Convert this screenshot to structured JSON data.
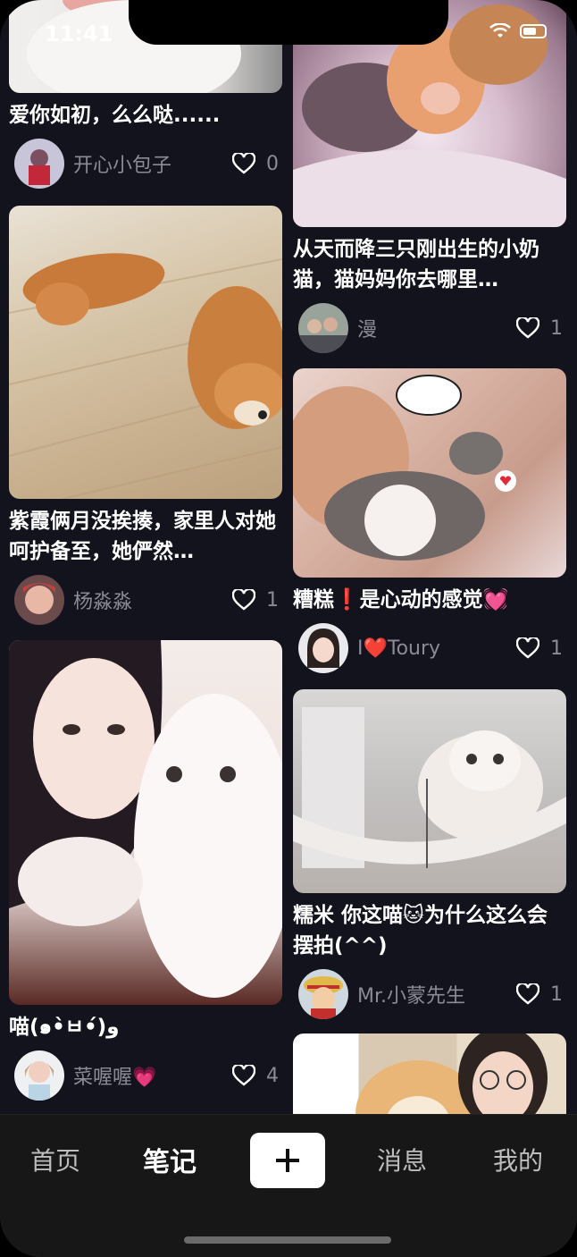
{
  "status_bar": {
    "time": "11:41"
  },
  "feed": {
    "left_column": [
      {
        "image": "white-dog-closeup-partial",
        "title": "爱你如初，么么哒......",
        "user": "开心小包子",
        "likes": "0",
        "avatar": "avatar-red-figure"
      },
      {
        "image": "two-shiba-dogs-on-floor",
        "title": "紫霞俩月没挨揍，家里人对她呵护备至，她俨然…",
        "user": "杨淼淼",
        "likes": "1",
        "avatar": "avatar-girl-red"
      },
      {
        "image": "girl-with-white-cats",
        "title": "喵(๑•̀ㅂ•́)و",
        "user": "菜喔喔💗",
        "likes": "4",
        "avatar": "avatar-girl-white"
      }
    ],
    "right_column": [
      {
        "image": "newborn-kittens-on-blanket",
        "title": "从天而降三只刚出生的小奶猫，猫妈妈你去哪里…",
        "user": "漫",
        "likes": "1",
        "avatar": "avatar-group-photo"
      },
      {
        "image": "two-cats-on-pink-bed",
        "title": "糟糕❗️是心动的感觉💓",
        "user": "I❤️Toury",
        "likes": "1",
        "avatar": "avatar-girl-smile"
      },
      {
        "image": "cat-in-hammock",
        "title": "糯米 你这喵🐱为什么这么会摆拍(^^)",
        "user": "Mr.小蒙先生",
        "likes": "1",
        "avatar": "avatar-straw-hat"
      },
      {
        "image": "girl-with-shiba-dog",
        "title": "",
        "user": "",
        "likes": "",
        "avatar": ""
      }
    ]
  },
  "tabbar": {
    "home": "首页",
    "notes": "笔记",
    "add": "+",
    "messages": "消息",
    "me": "我的"
  },
  "colors": {
    "background": "#12131d",
    "tabbar": "#171717",
    "text_primary": "#ffffff",
    "text_secondary": "#8b8b95"
  }
}
